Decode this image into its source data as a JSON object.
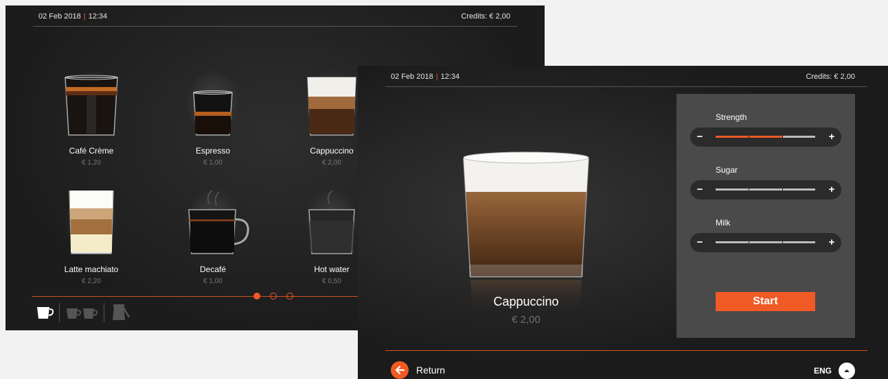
{
  "status_bar": {
    "date": "02 Feb 2018",
    "separator": "|",
    "time": "12:34",
    "credits": "Credits: € 2,00"
  },
  "menu": {
    "products": [
      {
        "name": "Café Crème",
        "price": "€ 1,20"
      },
      {
        "name": "Espresso",
        "price": "€ 1,00"
      },
      {
        "name": "Cappuccino",
        "price": "€ 2,00"
      },
      {
        "name": "Latte machiato",
        "price": "€ 2,20"
      },
      {
        "name": "Decafé",
        "price": "€ 1,00"
      },
      {
        "name": "Hot water",
        "price": "€ 0,50"
      }
    ],
    "page_count": 3,
    "active_page": 1,
    "size_options": [
      "single-cup-icon",
      "double-cup-icon",
      "pot-icon"
    ]
  },
  "detail": {
    "product_name": "Cappuccino",
    "product_price": "€ 2,00",
    "settings": [
      {
        "label": "Strength",
        "level": 2,
        "steps": 3
      },
      {
        "label": "Sugar",
        "level": 0,
        "steps": 3
      },
      {
        "label": "Milk",
        "level": 0,
        "steps": 3
      }
    ],
    "minus_symbol": "−",
    "plus_symbol": "+",
    "start_label": "Start",
    "return_label": "Return",
    "language": "ENG"
  },
  "colors": {
    "accent": "#f05a24",
    "background": "#1f1f1f",
    "panel": "#4a4a4a"
  }
}
